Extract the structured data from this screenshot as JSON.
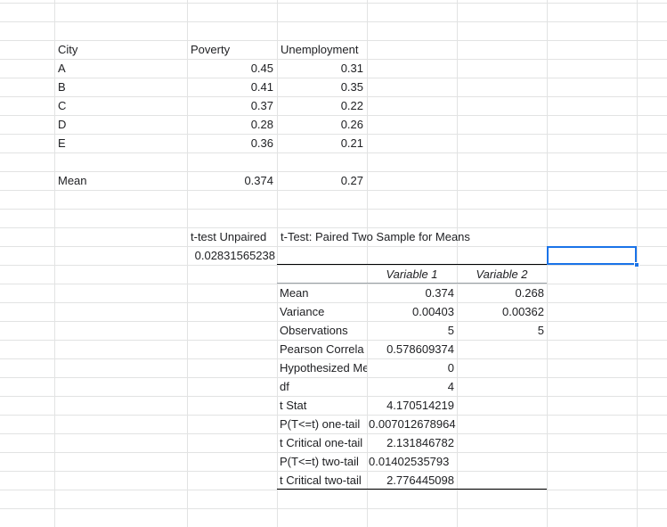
{
  "sheet": {
    "header": {
      "city": "City",
      "poverty": "Poverty",
      "unemployment": "Unemployment"
    },
    "rows": [
      {
        "city": "A",
        "poverty": "0.45",
        "unemployment": "0.31"
      },
      {
        "city": "B",
        "poverty": "0.41",
        "unemployment": "0.35"
      },
      {
        "city": "C",
        "poverty": "0.37",
        "unemployment": "0.22"
      },
      {
        "city": "D",
        "poverty": "0.28",
        "unemployment": "0.26"
      },
      {
        "city": "E",
        "poverty": "0.36",
        "unemployment": "0.21"
      }
    ],
    "mean": {
      "label": "Mean",
      "poverty": "0.374",
      "unemployment": "0.27"
    },
    "ttest_unpaired": {
      "label": "t-test Unpaired",
      "value": "0.02831565238"
    },
    "paired": {
      "title": "t-Test: Paired Two Sample for Means",
      "col1": "Variable 1",
      "col2": "Variable 2",
      "stats": [
        {
          "label": "Mean",
          "v1": "0.374",
          "v2": "0.268"
        },
        {
          "label": "Variance",
          "v1": "0.00403",
          "v2": "0.00362"
        },
        {
          "label": "Observations",
          "v1": "5",
          "v2": "5"
        },
        {
          "label": "Pearson Correla",
          "v1": "0.578609374",
          "v2": ""
        },
        {
          "label": "Hypothesized Me",
          "v1": "0",
          "v2": ""
        },
        {
          "label": "df",
          "v1": "4",
          "v2": ""
        },
        {
          "label": "t Stat",
          "v1": "4.170514219",
          "v2": ""
        },
        {
          "label": "P(T<=t) one-tail",
          "v1": "0.007012678964",
          "v2": ""
        },
        {
          "label": "t Critical one-tail",
          "v1": "2.131846782",
          "v2": ""
        },
        {
          "label": "P(T<=t) two-tail",
          "v1": "0.01402535793",
          "v2": ""
        },
        {
          "label": "t Critical two-tail",
          "v1": "2.776445098",
          "v2": ""
        }
      ]
    }
  }
}
